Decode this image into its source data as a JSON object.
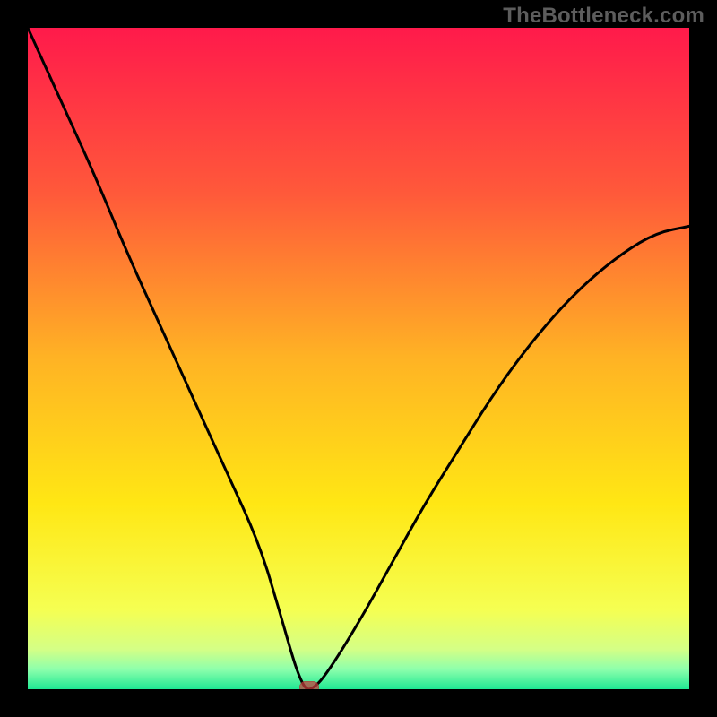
{
  "attribution": "TheBottleneck.com",
  "chart_data": {
    "type": "line",
    "title": "",
    "xlabel": "",
    "ylabel": "",
    "xlim": [
      0,
      100
    ],
    "ylim": [
      0,
      100
    ],
    "grid": false,
    "legend": false,
    "x": [
      0,
      5,
      10,
      15,
      20,
      25,
      30,
      35,
      38,
      40,
      41,
      42,
      43,
      45,
      50,
      55,
      60,
      65,
      70,
      75,
      80,
      85,
      90,
      95,
      100
    ],
    "values": [
      100,
      89,
      78,
      66,
      55,
      44,
      33,
      22,
      12,
      5,
      2,
      0,
      0,
      2,
      10,
      19,
      28,
      36,
      44,
      51,
      57,
      62,
      66,
      69,
      70
    ],
    "marker": {
      "x": 42.5,
      "y": 0
    },
    "gradient_stops": [
      {
        "offset": 0.0,
        "color": "#ff1a4b"
      },
      {
        "offset": 0.25,
        "color": "#ff593a"
      },
      {
        "offset": 0.5,
        "color": "#ffb324"
      },
      {
        "offset": 0.72,
        "color": "#ffe714"
      },
      {
        "offset": 0.88,
        "color": "#f5ff52"
      },
      {
        "offset": 0.94,
        "color": "#d4ff86"
      },
      {
        "offset": 0.97,
        "color": "#8dffac"
      },
      {
        "offset": 1.0,
        "color": "#1fe993"
      }
    ]
  }
}
